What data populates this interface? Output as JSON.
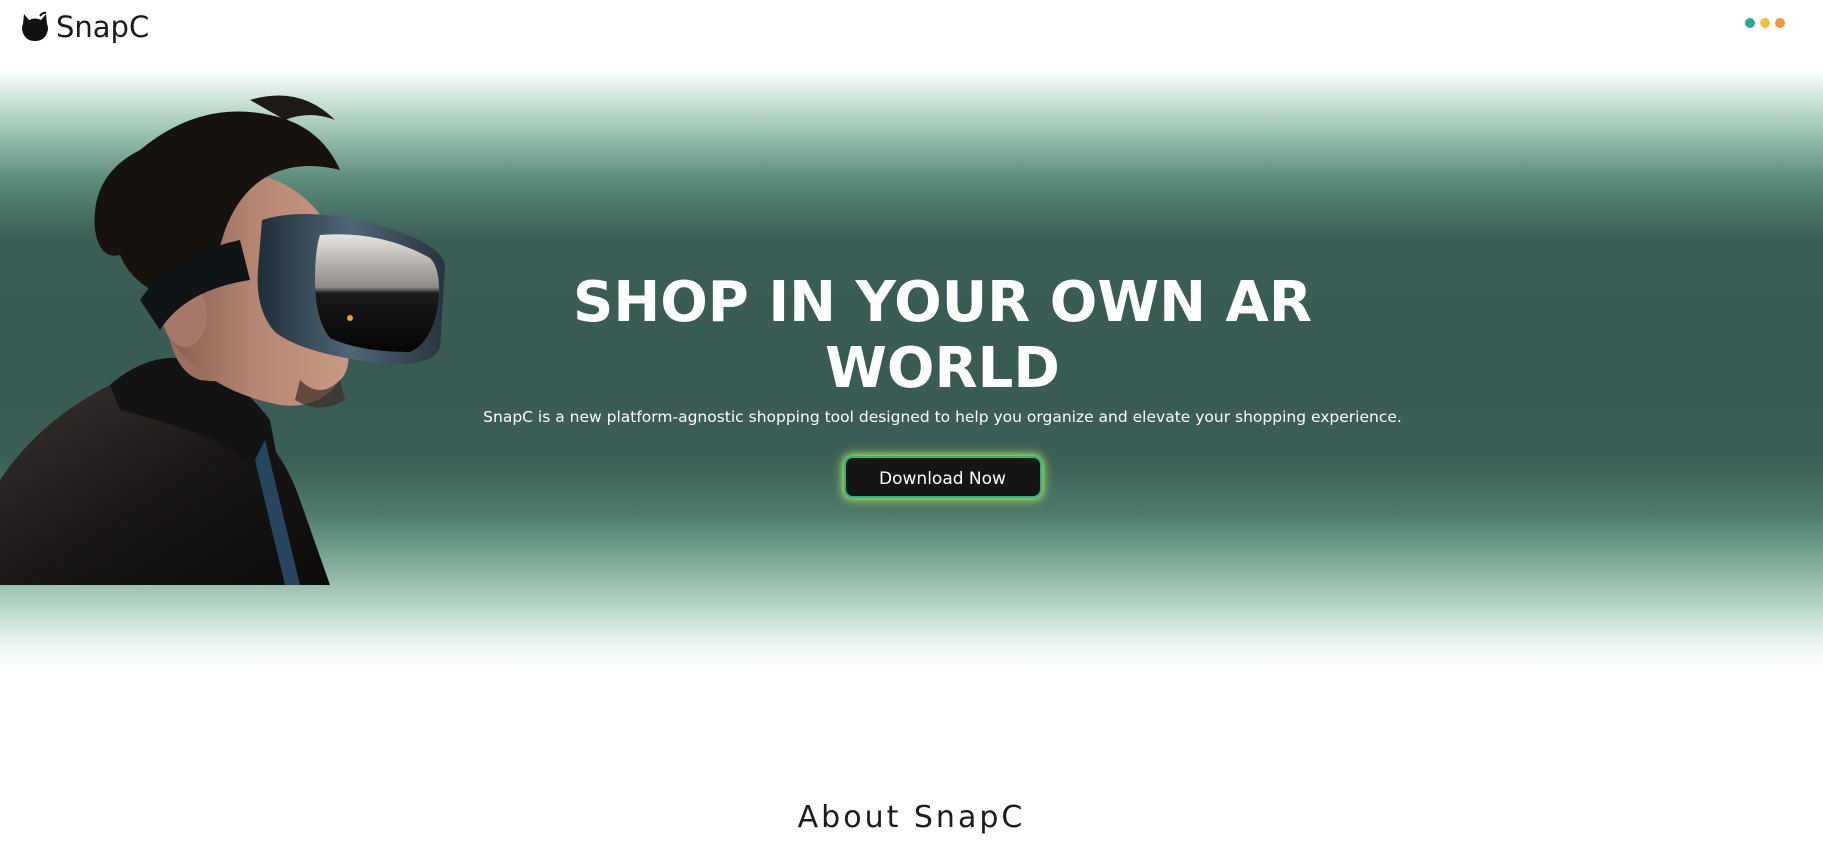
{
  "header": {
    "brand": "SnapC",
    "logo_icon": "cat-head-icon",
    "menu_icon": "three-dots-menu-icon",
    "menu_dot_colors": [
      "#2aa79b",
      "#f3c13a",
      "#ee9a3a"
    ]
  },
  "hero": {
    "title": "SHOP IN YOUR OWN AR WORLD",
    "subtitle": "SnapC is a new platform-agnostic shopping tool designed to help you organize and elevate your shopping experience.",
    "cta_label": "Download Now",
    "image": "man-wearing-vr-headset",
    "background_color": "#3a5f56"
  },
  "about": {
    "title": "About SnapC"
  }
}
